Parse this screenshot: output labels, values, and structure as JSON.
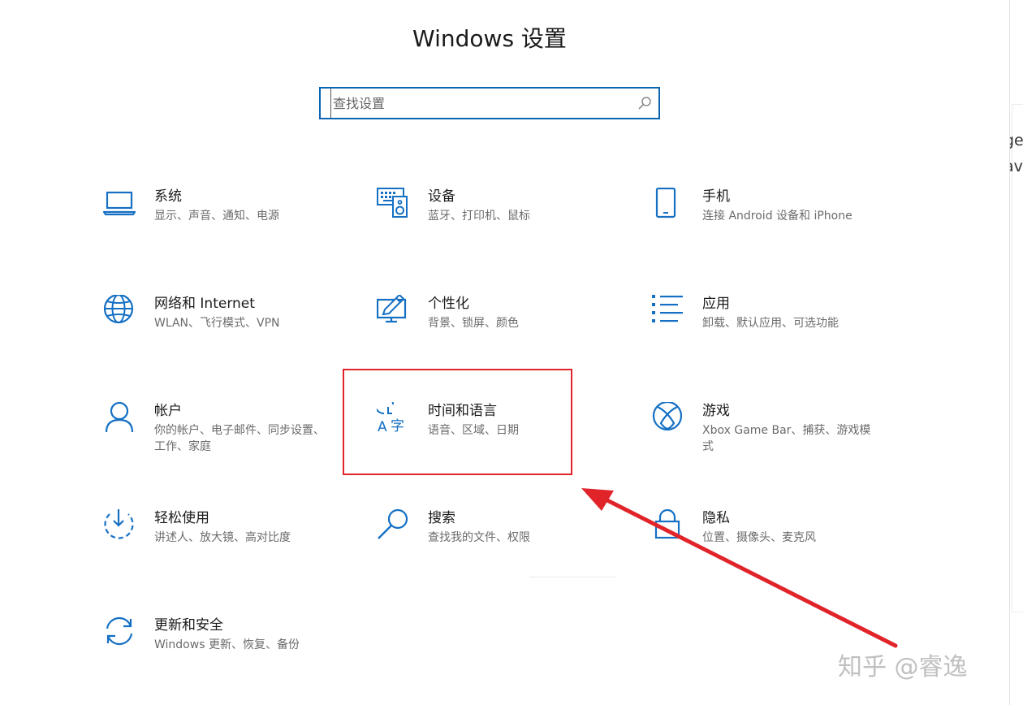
{
  "window": {
    "title": "Windows 设置"
  },
  "search": {
    "placeholder": "查找设置",
    "icon": "search-icon"
  },
  "tiles": [
    {
      "name": "系统",
      "desc": "显示、声音、通知、电源",
      "icon": "laptop-icon"
    },
    {
      "name": "设备",
      "desc": "蓝牙、打印机、鼠标",
      "icon": "devices-icon"
    },
    {
      "name": "手机",
      "desc": "连接 Android 设备和 iPhone",
      "icon": "phone-icon"
    },
    {
      "name": "网络和 Internet",
      "desc": "WLAN、飞行模式、VPN",
      "icon": "globe-icon"
    },
    {
      "name": "个性化",
      "desc": "背景、锁屏、颜色",
      "icon": "paint-icon"
    },
    {
      "name": "应用",
      "desc": "卸载、默认应用、可选功能",
      "icon": "apps-list-icon"
    },
    {
      "name": "帐户",
      "desc": "你的帐户、电子邮件、同步设置、工作、家庭",
      "icon": "person-icon"
    },
    {
      "name": "时间和语言",
      "desc": "语音、区域、日期",
      "icon": "time-language-icon"
    },
    {
      "name": "游戏",
      "desc": "Xbox Game Bar、捕获、游戏模式",
      "icon": "xbox-icon"
    },
    {
      "name": "轻松使用",
      "desc": "讲述人、放大镜、高对比度",
      "icon": "ease-of-access-icon"
    },
    {
      "name": "搜索",
      "desc": "查找我的文件、权限",
      "icon": "search-magnifier-icon"
    },
    {
      "name": "隐私",
      "desc": "位置、摄像头、麦克风",
      "icon": "lock-icon"
    },
    {
      "name": "更新和安全",
      "desc": "Windows 更新、恢复、备份",
      "icon": "update-sync-icon"
    }
  ],
  "annotation": {
    "highlight_color": "#e0242a",
    "arrow_color": "#e0242a"
  },
  "watermark": {
    "text": "知乎 @睿逸"
  },
  "edge_fragments": [
    "ge",
    "av"
  ],
  "colors": {
    "accent": "#0a64b4",
    "icon": "#1570c4"
  }
}
